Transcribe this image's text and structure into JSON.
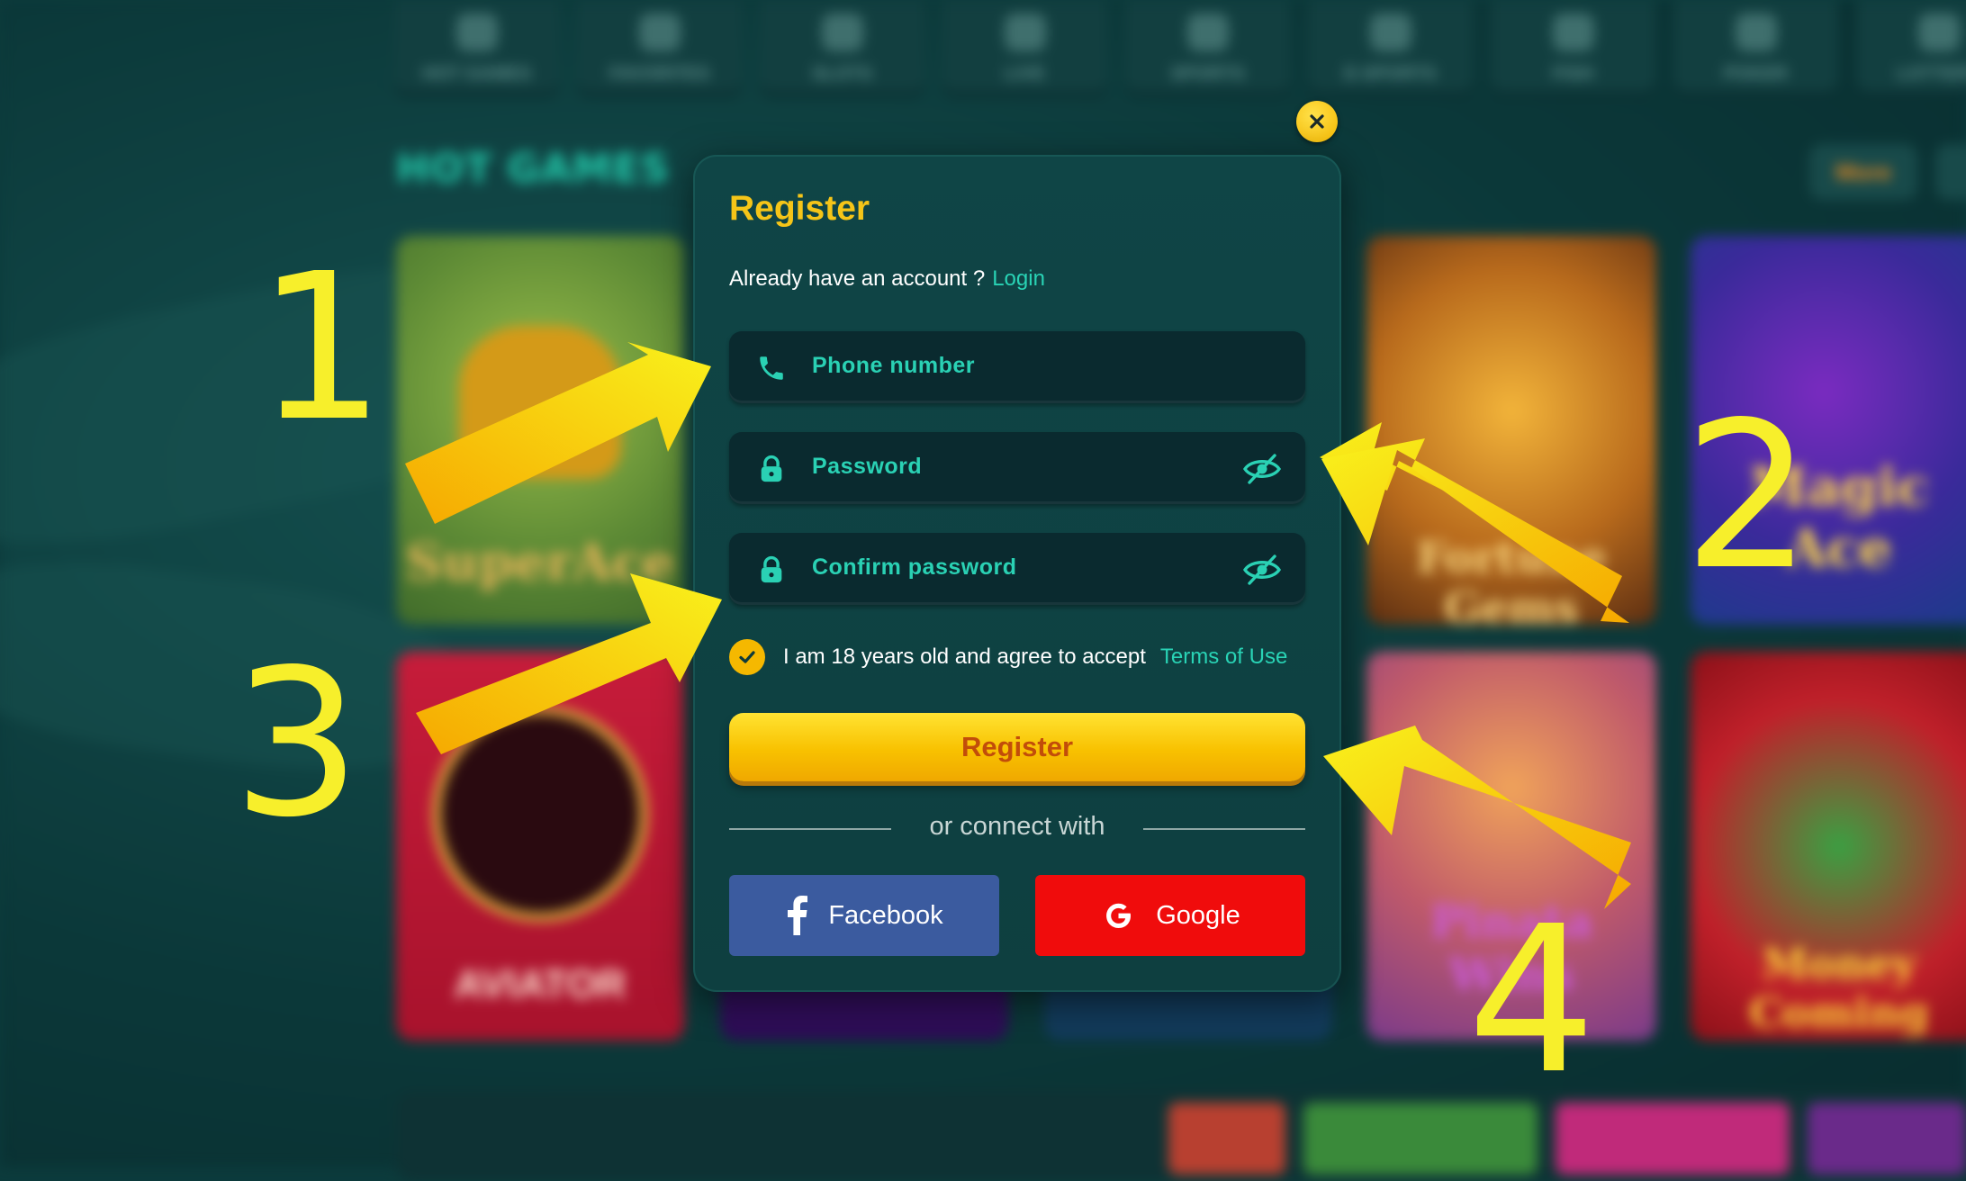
{
  "background": {
    "nav_items": [
      "HOT GAMES",
      "FAVORITES",
      "SLOTS",
      "LIVE",
      "SPORTS",
      "E-SPORTS",
      "FISH",
      "POKER",
      "LOTTERY"
    ],
    "section_title": "HOT GAMES",
    "more_label": "More",
    "tiles": [
      {
        "label": "SuperAce"
      },
      {
        "label": "AVIATOR"
      },
      {
        "label": "Fortune Gems"
      },
      {
        "label": "Magic Ace"
      },
      {
        "label": "Pinata Wins"
      },
      {
        "label": "Money Coming"
      }
    ]
  },
  "modal": {
    "title": "Register",
    "account_prompt": "Already have an account ?",
    "login_link": "Login",
    "phone_placeholder": "Phone number",
    "password_placeholder": "Password",
    "confirm_placeholder": "Confirm password",
    "agree_text": "I am 18 years old and agree to accept",
    "terms_link": "Terms of Use",
    "register_button": "Register",
    "or_connect": "or connect with",
    "facebook_button": "Facebook",
    "google_button": "Google"
  },
  "annotations": {
    "step1": "1",
    "step2": "2",
    "step3": "3",
    "step4": "4"
  },
  "colors": {
    "accent_yellow": "#f5c518",
    "accent_teal": "#29d3b5",
    "modal_bg": "#0f4546",
    "facebook_blue": "#3b5b9f",
    "google_red": "#f00c0c",
    "annotation_yellow": "#f7ef2b"
  }
}
